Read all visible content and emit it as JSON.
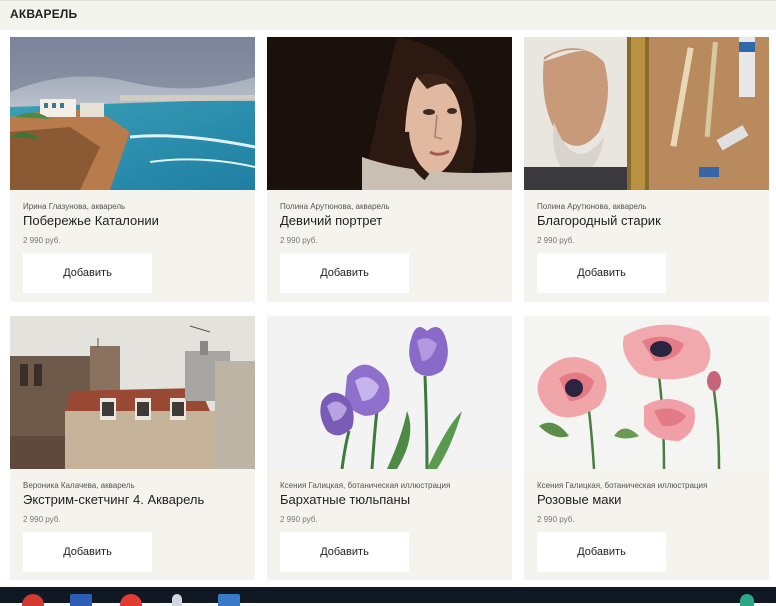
{
  "header": {
    "title": "АКВАРЕЛЬ"
  },
  "add_label": "Добавить",
  "products": [
    {
      "meta": "Ирина Глазунова, акварель",
      "name": "Побережье Каталонии",
      "price": "2 990 руб."
    },
    {
      "meta": "Полина Арутюнова, акварель",
      "name": "Девичий портрет",
      "price": "2 990 руб."
    },
    {
      "meta": "Полина Арутюнова, акварель",
      "name": "Благородный старик",
      "price": "2 990 руб."
    },
    {
      "meta": "Вероника Калачева, акварель",
      "name": "Экстрим-скетчинг 4. Акварель",
      "price": "2 990 руб."
    },
    {
      "meta": "Ксения Галицкая, ботаническая иллюстрация",
      "name": "Бархатные тюльпаны",
      "price": "2 990 руб."
    },
    {
      "meta": "Ксения Галицкая, ботаническая иллюстрация",
      "name": "Розовые маки",
      "price": "2 990 руб."
    }
  ],
  "colors": {
    "card_bg": "#f4f3ed",
    "taskbar_bg": "#101824",
    "button_bg": "#ffffff"
  },
  "taskbar_icons": [
    "chrome-icon",
    "word-icon",
    "yandex-icon",
    "user-icon",
    "mail-icon",
    "tray-icon"
  ]
}
